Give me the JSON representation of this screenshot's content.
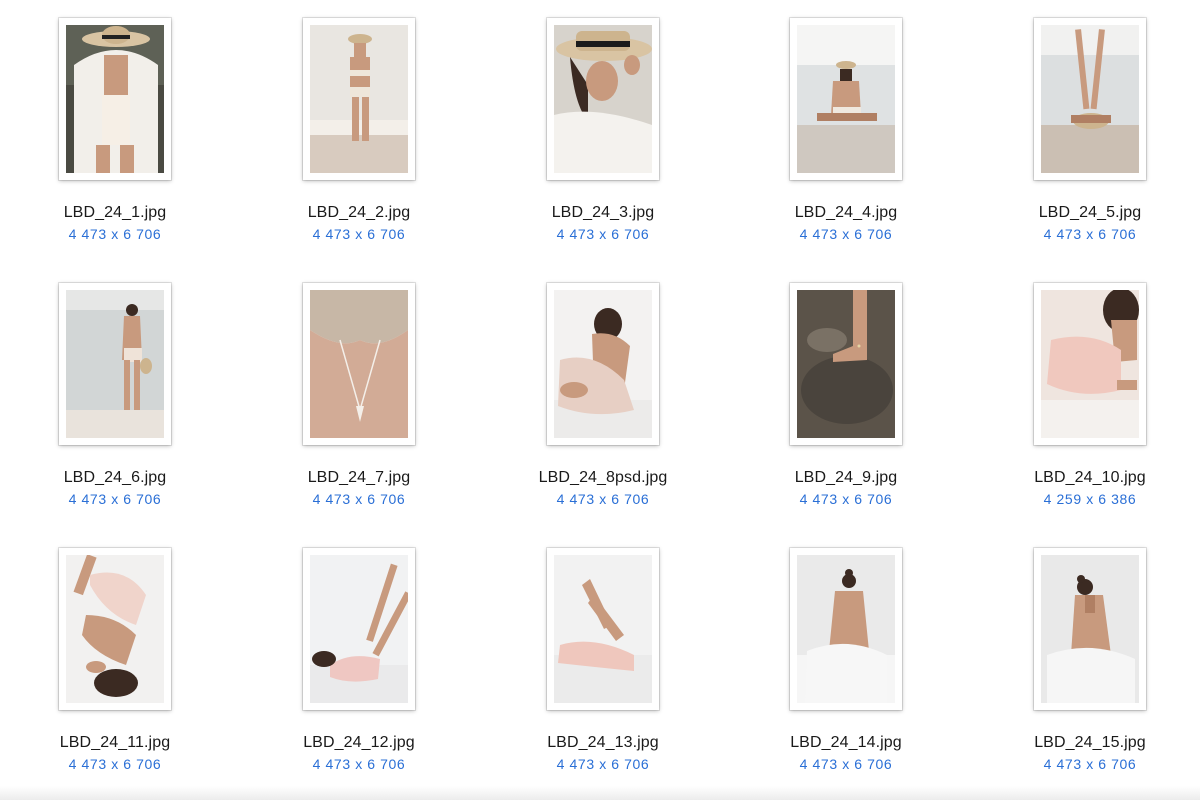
{
  "files": [
    {
      "name": "LBD_24_1.jpg",
      "dimensions": "4 473 x 6 706",
      "scene": "beach-hat-white-shirt"
    },
    {
      "name": "LBD_24_2.jpg",
      "dimensions": "4 473 x 6 706",
      "scene": "beach-standing"
    },
    {
      "name": "LBD_24_3.jpg",
      "dimensions": "4 473 x 6 706",
      "scene": "hat-closeup"
    },
    {
      "name": "LBD_24_4.jpg",
      "dimensions": "4 473 x 6 706",
      "scene": "beach-sitting-back"
    },
    {
      "name": "LBD_24_5.jpg",
      "dimensions": "4 473 x 6 706",
      "scene": "beach-legs-up"
    },
    {
      "name": "LBD_24_6.jpg",
      "dimensions": "4 473 x 6 706",
      "scene": "sea-standing-back"
    },
    {
      "name": "LBD_24_7.jpg",
      "dimensions": "4 473 x 6 706",
      "scene": "back-necklace"
    },
    {
      "name": "LBD_24_8psd.jpg",
      "dimensions": "4 473 x 6 706",
      "scene": "bed-sitting-dress"
    },
    {
      "name": "LBD_24_9.jpg",
      "dimensions": "4 473 x 6 706",
      "scene": "foot-on-rock"
    },
    {
      "name": "LBD_24_10.jpg",
      "dimensions": "4 259 x 6 386",
      "scene": "bed-lying-dress"
    },
    {
      "name": "LBD_24_11.jpg",
      "dimensions": "4 473 x 6 706",
      "scene": "bed-lying-upside"
    },
    {
      "name": "LBD_24_12.jpg",
      "dimensions": "4 473 x 6 706",
      "scene": "legs-up-heels"
    },
    {
      "name": "LBD_24_13.jpg",
      "dimensions": "4 473 x 6 706",
      "scene": "legs-crossed-bed"
    },
    {
      "name": "LBD_24_14.jpg",
      "dimensions": "4 473 x 6 706",
      "scene": "bed-back-bun"
    },
    {
      "name": "LBD_24_15.jpg",
      "dimensions": "4 473 x 6 706",
      "scene": "bed-back-shoulder"
    }
  ],
  "colors": {
    "filename": "#1a1a1a",
    "dimensions": "#2a6fd6",
    "background": "#ffffff"
  }
}
